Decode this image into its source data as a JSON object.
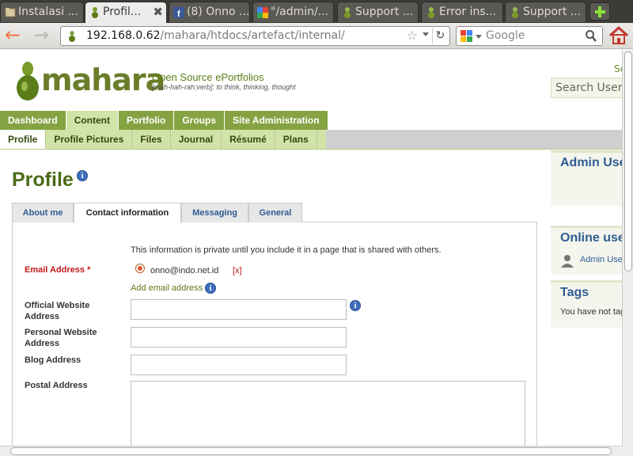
{
  "browser": {
    "tabs": [
      {
        "label": "Instalasi ...",
        "active": false
      },
      {
        "label": "Profil...",
        "active": true
      },
      {
        "label": "(8) Onno ...",
        "active": false
      },
      {
        "label": "\"/admin/...",
        "active": false
      },
      {
        "label": "Support ...",
        "active": false
      },
      {
        "label": "Error ins...",
        "active": false
      },
      {
        "label": "Support ...",
        "active": false
      }
    ],
    "close_glyph": "✖",
    "url_host": "192.168.0.62",
    "url_path": "/mahara/htdocs/artefact/internal/",
    "search_placeholder": "Google"
  },
  "site": {
    "logo_text": "mahara",
    "tagline": "Open Source ePortfolios",
    "pronunciation": "[mah-hah-rah;verb]: to think, thinking, thought",
    "top_link": "Se",
    "search_users_placeholder": "Search Users"
  },
  "main_nav": [
    {
      "label": "Dashboard",
      "active": false
    },
    {
      "label": "Content",
      "active": true
    },
    {
      "label": "Portfolio",
      "active": false
    },
    {
      "label": "Groups",
      "active": false
    },
    {
      "label": "Site Administration",
      "active": false
    }
  ],
  "sub_nav": [
    {
      "label": "Profile",
      "active": true
    },
    {
      "label": "Profile Pictures",
      "active": false
    },
    {
      "label": "Files",
      "active": false
    },
    {
      "label": "Journal",
      "active": false
    },
    {
      "label": "Résumé",
      "active": false
    },
    {
      "label": "Plans",
      "active": false
    }
  ],
  "page": {
    "title": "Profile",
    "info_glyph": "i",
    "tabs": [
      {
        "label": "About me",
        "active": false
      },
      {
        "label": "Contact information",
        "active": true
      },
      {
        "label": "Messaging",
        "active": false
      },
      {
        "label": "General",
        "active": false
      }
    ],
    "notice": "This information is private until you include it in a page that is shared with others.",
    "fields": {
      "email_label": "Email Address *",
      "email_value": "onno@indo.net.id",
      "delete_link": "[x]",
      "add_email": "Add email address",
      "official_website_label_1": "Official Website",
      "official_website_label_2": "Address",
      "personal_website_label_1": "Personal Website",
      "personal_website_label_2": "Address",
      "blog_label": "Blog Address",
      "postal_label": "Postal Address"
    }
  },
  "sidebar": {
    "admin_title": "Admin Users",
    "online_title": "Online users",
    "online_user": "Admin User",
    "tags_title": "Tags",
    "tags_empty": "You have not tagged anything"
  },
  "colors": {
    "brand_green": "#85a343",
    "title_green": "#4a6b14",
    "link_blue": "#2f5c92",
    "required_red": "#c01818"
  }
}
